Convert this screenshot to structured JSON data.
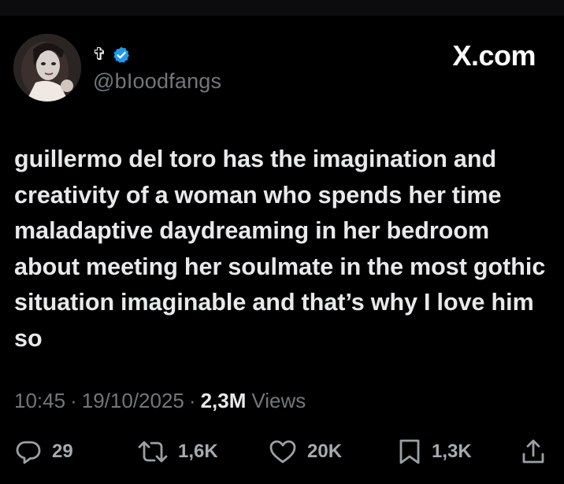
{
  "colors": {
    "background": "#000000",
    "text_primary": "#e7e9ea",
    "text_secondary": "#71767b",
    "verified_blue": "#1d9bf0"
  },
  "header": {
    "display_name": "✞",
    "verified_icon": "verified-badge-icon",
    "handle": "@bIoodfangs",
    "brand": "X.com"
  },
  "tweet": {
    "text": "guillermo del toro has the imagination and creativity of a woman who spends her time maladaptive daydreaming in her bedroom about meeting her soulmate in the most gothic situation imaginable and that’s why I love him so"
  },
  "meta": {
    "time": "10:45",
    "separator": "·",
    "date": "19/10/2025",
    "views_count": "2,3M",
    "views_label": "Views"
  },
  "actions": {
    "replies": {
      "icon": "reply-icon",
      "count": "29"
    },
    "reposts": {
      "icon": "repost-icon",
      "count": "1,6K"
    },
    "likes": {
      "icon": "heart-icon",
      "count": "20K"
    },
    "bookmarks": {
      "icon": "bookmark-icon",
      "count": "1,3K"
    },
    "share": {
      "icon": "share-icon"
    }
  }
}
